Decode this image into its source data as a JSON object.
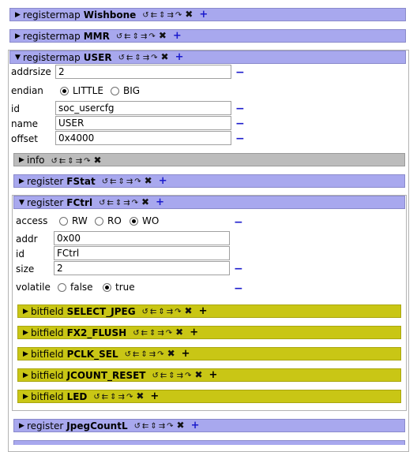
{
  "action_icons": [
    "refresh-icon",
    "arrow-left-icon",
    "arrow-updown-icon",
    "arrow-right-icon",
    "redo-icon",
    "delete-icon",
    "add-icon"
  ],
  "registermaps": [
    {
      "kind": "registermap",
      "name": "Wishbone"
    },
    {
      "kind": "registermap",
      "name": "MMR"
    },
    {
      "kind": "registermap",
      "name": "USER"
    }
  ],
  "user": {
    "addrsize_label": "addrsize",
    "addrsize_value": "2",
    "endian_label": "endian",
    "endian_options": [
      "LITTLE",
      "BIG"
    ],
    "endian_selected": "LITTLE",
    "id_label": "id",
    "id_value": "soc_usercfg",
    "name_label": "name",
    "name_value": "USER",
    "offset_label": "offset",
    "offset_value": "0x4000",
    "info_label": "info"
  },
  "registers": [
    {
      "kind": "register",
      "name": "FStat"
    },
    {
      "kind": "register",
      "name": "FCtrl"
    },
    {
      "kind": "register",
      "name": "JpegCountL"
    }
  ],
  "fctrl": {
    "access_label": "access",
    "access_options": [
      "RW",
      "RO",
      "WO"
    ],
    "access_selected": "WO",
    "addr_label": "addr",
    "addr_value": "0x00",
    "id_label": "id",
    "id_value": "FCtrl",
    "size_label": "size",
    "size_value": "2",
    "volatile_label": "volatile",
    "volatile_options": [
      "false",
      "true"
    ],
    "volatile_selected": "true"
  },
  "bitfields": [
    {
      "kind": "bitfield",
      "name": "SELECT_JPEG"
    },
    {
      "kind": "bitfield",
      "name": "FX2_FLUSH"
    },
    {
      "kind": "bitfield",
      "name": "PCLK_SEL"
    },
    {
      "kind": "bitfield",
      "name": "JCOUNT_RESET"
    },
    {
      "kind": "bitfield",
      "name": "LED"
    }
  ],
  "colors": {
    "registermap_header": "#a8a8ee",
    "info_header": "#bcbcbc",
    "bitfield_header": "#c9c615",
    "add_sign": "#1a1acc"
  }
}
